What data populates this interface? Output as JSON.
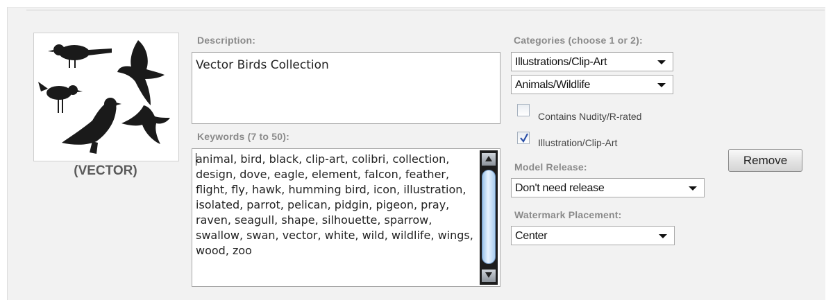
{
  "thumbnail": {
    "caption": "(VECTOR)"
  },
  "description": {
    "label": "Description:",
    "value": "Vector Birds Collection"
  },
  "keywords": {
    "label": "Keywords (7 to 50):",
    "value": "animal, bird, black, clip-art, colibri, collection, design, dove, eagle, element, falcon, feather, flight, fly, hawk, humming bird, icon, illustration, isolated, parrot, pelican, pidgin, pigeon, pray, raven, seagull, shape, silhouette, sparrow, swallow, swan, vector, white, wild, wildlife, wings, wood, zoo"
  },
  "categories": {
    "label": "Categories (choose 1 or 2):",
    "primary": "Illustrations/Clip-Art",
    "secondary": "Animals/Wildlife"
  },
  "checkboxes": {
    "nudity": {
      "label": "Contains Nudity/R-rated",
      "checked": false
    },
    "illustration": {
      "label": "Illustration/Clip-Art",
      "checked": true
    }
  },
  "model_release": {
    "label": "Model Release:",
    "value": "Don't need release"
  },
  "watermark": {
    "label": "Watermark Placement:",
    "value": "Center"
  },
  "remove_button": {
    "label": "Remove"
  },
  "icons": [
    "bird-thumbnail",
    "scroll-up-icon",
    "scroll-down-icon",
    "dropdown-arrow-icon",
    "checkmark-icon"
  ]
}
